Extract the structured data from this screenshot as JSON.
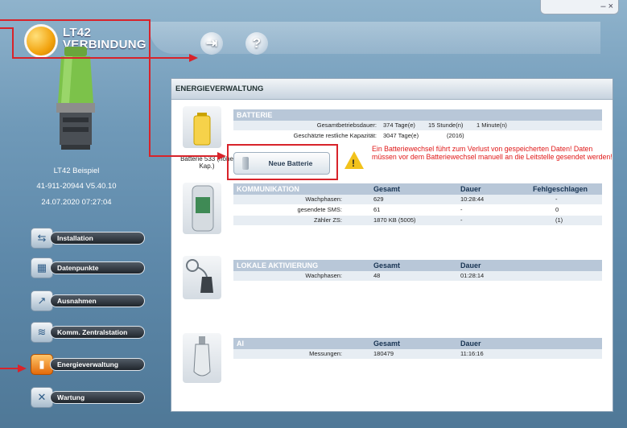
{
  "window": {
    "controls": "– ×"
  },
  "brand": {
    "line1": "LT42",
    "line2": "VERBINDUNG"
  },
  "toolbar": {
    "exit_glyph": "⇥",
    "help_glyph": "?"
  },
  "device": {
    "name": "LT42 Beispiel",
    "id_version": "41-911-20944   V5.40.10",
    "datetime": "24.07.2020 07:27:04"
  },
  "nav": [
    {
      "label": "Installation",
      "icon": "installation-icon",
      "glyph": "⇆",
      "active": false
    },
    {
      "label": "Datenpunkte",
      "icon": "datapoints-icon",
      "glyph": "▦",
      "active": false
    },
    {
      "label": "Ausnahmen",
      "icon": "exceptions-icon",
      "glyph": "↗",
      "active": false
    },
    {
      "label": "Komm. Zentralstation",
      "icon": "central-station-icon",
      "glyph": "≋",
      "active": false
    },
    {
      "label": "Energieverwaltung",
      "icon": "energy-icon",
      "glyph": "▮",
      "active": true
    },
    {
      "label": "Wartung",
      "icon": "maintenance-icon",
      "glyph": "✕",
      "active": false
    }
  ],
  "panel": {
    "title": "ENERGIEVERWALTUNG",
    "battery": {
      "header": "BATTERIE",
      "runtime_label": "Gesamtbetriebsdauer:",
      "runtime_days": "374 Tage(e)",
      "runtime_hours": "15 Stunde(n)",
      "runtime_minutes": "1 Minute(n)",
      "remaining_label": "Geschätzte restliche Kapazität:",
      "remaining_days": "3047 Tage(e)",
      "remaining_year": "(2016)",
      "battery_label": "Batterie 533 (hohe Kap.)",
      "new_battery_button": "Neue Batterie",
      "warning": "Ein Batteriewechsel führt zum Verlust von gespeicherten Daten! Daten müssen vor dem Batteriewechsel manuell an die Leitstelle gesendet werden!"
    },
    "communication": {
      "header": "KOMMUNIKATION",
      "columns": [
        "Gesamt",
        "Dauer",
        "Fehlgeschlagen"
      ],
      "rows": [
        {
          "label": "Wachphasen:",
          "total": "629",
          "duration": "10:28:44",
          "failed": "-"
        },
        {
          "label": "gesendete SMS:",
          "total": "61",
          "duration": "-",
          "failed": "0"
        },
        {
          "label": "Zähler ZS:",
          "total": "1870 KB (5005)",
          "duration": "-",
          "failed": "(1)"
        }
      ]
    },
    "local_activation": {
      "header": "LOKALE AKTIVIERUNG",
      "columns": [
        "Gesamt",
        "Dauer"
      ],
      "rows": [
        {
          "label": "Wachphasen:",
          "total": "48",
          "duration": "01:28:14"
        }
      ]
    },
    "ai": {
      "header": "AI",
      "columns": [
        "Gesamt",
        "Dauer"
      ],
      "rows": [
        {
          "label": "Messungen:",
          "total": "180479",
          "duration": "11:16:16"
        }
      ]
    }
  },
  "colors": {
    "annotation": "#d8232a",
    "accent_orange": "#f2a20c",
    "warning_text": "#e01818"
  }
}
